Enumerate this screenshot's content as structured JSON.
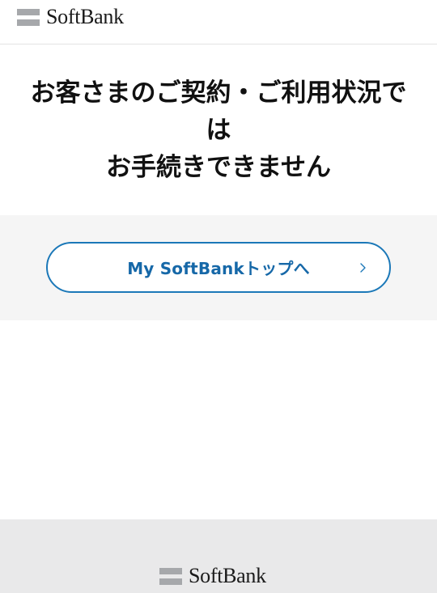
{
  "header": {
    "logo_text": "SoftBank"
  },
  "message": {
    "title_line1": "お客さまのご契約・ご利用状況で",
    "title_line2": "は",
    "title_line3": "お手続きできません"
  },
  "action": {
    "button_label": "My SoftBankトップへ",
    "button_icon": "chevron-right-icon"
  },
  "footer": {
    "logo_text": "SoftBank"
  },
  "colors": {
    "accent": "#1b78b8",
    "band_background": "#f5f5f5",
    "footer_background": "#e9e9ea",
    "logo_mark": "#a6a8ab"
  }
}
